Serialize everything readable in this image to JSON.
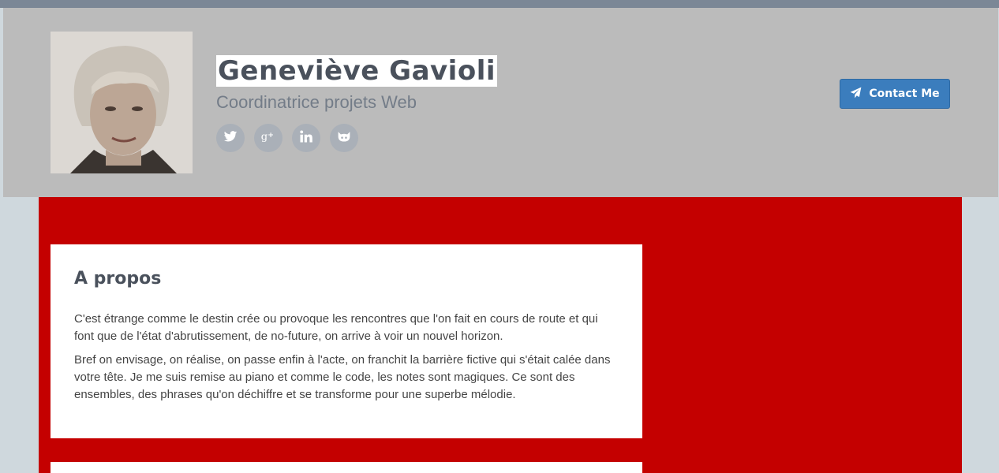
{
  "profile": {
    "name": "Geneviève Gavioli",
    "title": "Coordinatrice projets Web"
  },
  "social_links": [
    {
      "icon": "twitter-icon"
    },
    {
      "icon": "google-plus-icon"
    },
    {
      "icon": "linkedin-icon"
    },
    {
      "icon": "github-icon"
    }
  ],
  "contact": {
    "label": "Contact Me",
    "icon": "paper-plane-icon"
  },
  "about": {
    "heading": "A propos",
    "paragraphs": [
      "C'est étrange comme le destin crée ou provoque les rencontres que l'on fait en cours de route et qui font que de l'état d'abrutissement, de no-future, on arrive à voir un nouvel horizon.",
      "Bref on envisage, on réalise, on passe enfin à l'acte, on franchit la barrière fictive qui s'était calée dans votre tête. Je me suis remise au piano et comme le code, les notes sont magiques. Ce sont des ensembles, des phrases qu'on déchiffre et se transforme pour une superbe mélodie."
    ]
  },
  "colors": {
    "header_bg": "#bbbbbb",
    "top_bar": "#7b8796",
    "main_bg": "#c40000",
    "page_bg": "#cfd8dd",
    "accent": "#3b7dbd",
    "social_bg": "#aab0b8"
  }
}
